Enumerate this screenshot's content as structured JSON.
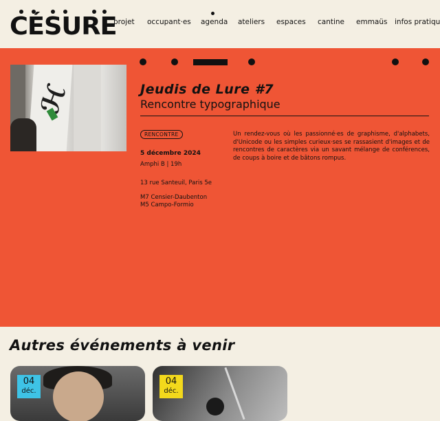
{
  "header": {
    "logo_text": "CÉSURE",
    "nav": [
      {
        "label": "projet"
      },
      {
        "label": "occupant·es"
      },
      {
        "label": "agenda"
      },
      {
        "label": "ateliers"
      },
      {
        "label": "espaces"
      },
      {
        "label": "cantine"
      },
      {
        "label": "emmaüs"
      },
      {
        "label": "infos pratiques"
      }
    ],
    "active_nav": "agenda"
  },
  "event": {
    "title": "Jeudis de Lure #7",
    "subtitle": "Rencontre typographique",
    "tag": "RENCONTRE",
    "date": "5 décembre 2024",
    "room": "Amphi B | 19h",
    "address": "13 rue Santeuil, Paris 5e",
    "transport": [
      "M7 Censier-Daubenton",
      "M5 Campo-Formio"
    ],
    "description": "Un rendez-vous où les passionné·es de graphisme, d'alphabets, d'Unicode ou les simples curieux·ses se rassasient d'images et de rencontres de caractères via un savant mélange de conférences, de coups à boire et de bâtons rompus."
  },
  "upcoming": {
    "title": "Autres événements à venir",
    "cards": [
      {
        "day": "04",
        "month": "déc.",
        "badge_color": "#3ec3e6"
      },
      {
        "day": "04",
        "month": "déc.",
        "badge_color": "#f3d91c"
      }
    ]
  },
  "colors": {
    "background": "#f4efe3",
    "hero": "#ef5535",
    "text": "#111111"
  }
}
